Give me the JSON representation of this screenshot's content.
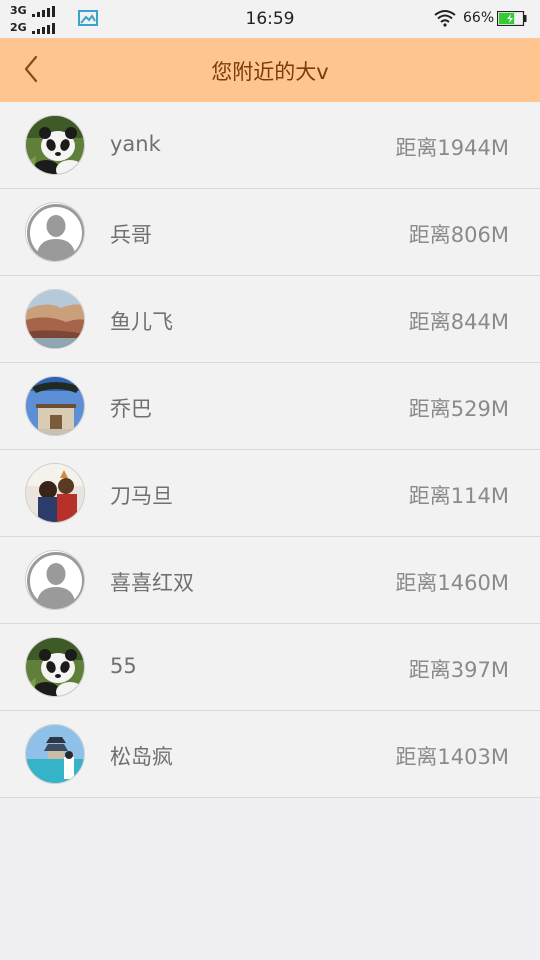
{
  "status_bar": {
    "network_1": "3G",
    "network_2": "2G",
    "time": "16:59",
    "battery_percent": "66%",
    "battery_level": 0.66,
    "battery_color": "#33cc33"
  },
  "header": {
    "title": "您附近的大v",
    "background_color": "#ffc591",
    "back_icon": "chevron-left-icon"
  },
  "users": [
    {
      "name": "yank",
      "distance": "距离1944M",
      "avatar": "panda-photo"
    },
    {
      "name": "兵哥",
      "distance": "距离806M",
      "avatar": "default-person"
    },
    {
      "name": "鱼儿飞",
      "distance": "距离844M",
      "avatar": "landscape-photo"
    },
    {
      "name": "乔巴",
      "distance": "距离529M",
      "avatar": "building-photo"
    },
    {
      "name": "刀马旦",
      "distance": "距离114M",
      "avatar": "people-photo"
    },
    {
      "name": "喜喜红双",
      "distance": "距离1460M",
      "avatar": "default-person"
    },
    {
      "name": "55",
      "distance": "距离397M",
      "avatar": "panda-photo"
    },
    {
      "name": "松岛疯",
      "distance": "距离1403M",
      "avatar": "lake-temple-photo"
    }
  ]
}
